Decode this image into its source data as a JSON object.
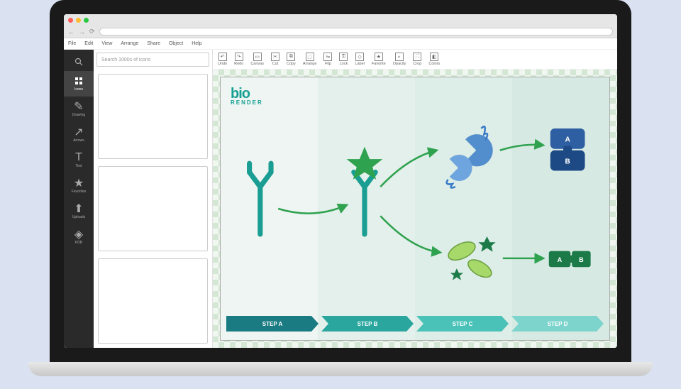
{
  "menu": [
    "File",
    "Edit",
    "View",
    "Arrange",
    "Share",
    "Object",
    "Help"
  ],
  "sidebar": [
    {
      "label": "Icons",
      "icon": "grid",
      "active": true
    },
    {
      "label": "Drawing",
      "icon": "pencil"
    },
    {
      "label": "Arrows",
      "icon": "arrow"
    },
    {
      "label": "Text",
      "icon": "text"
    },
    {
      "label": "Favorites",
      "icon": "star"
    },
    {
      "label": "Uploads",
      "icon": "upload"
    },
    {
      "label": "PDB",
      "icon": "db"
    }
  ],
  "search": {
    "placeholder": "Search 1000s of icons"
  },
  "toolbar": [
    {
      "label": "Undo",
      "icon": "↶"
    },
    {
      "label": "Redo",
      "icon": "↷"
    },
    {
      "label": "Canvas",
      "icon": "▭"
    },
    {
      "label": "Cut",
      "icon": "✂"
    },
    {
      "label": "Copy",
      "icon": "⧉"
    },
    {
      "label": "Arrange",
      "icon": "⬚"
    },
    {
      "label": "Flip",
      "icon": "⇋"
    },
    {
      "label": "Lock",
      "icon": "🔒"
    },
    {
      "label": "Label",
      "icon": "◇"
    },
    {
      "label": "Favorite",
      "icon": "★"
    },
    {
      "label": "Opacity",
      "icon": "◐"
    },
    {
      "label": "Crop",
      "icon": "⛶"
    },
    {
      "label": "Colors",
      "icon": "◧"
    }
  ],
  "logo": {
    "top": "bio",
    "bottom": "RENDER"
  },
  "steps": [
    "STEP A",
    "STEP B",
    "STEP C",
    "STEP D"
  ],
  "blocks": {
    "a": "A",
    "b": "B",
    "a2": "A",
    "b2": "B"
  }
}
